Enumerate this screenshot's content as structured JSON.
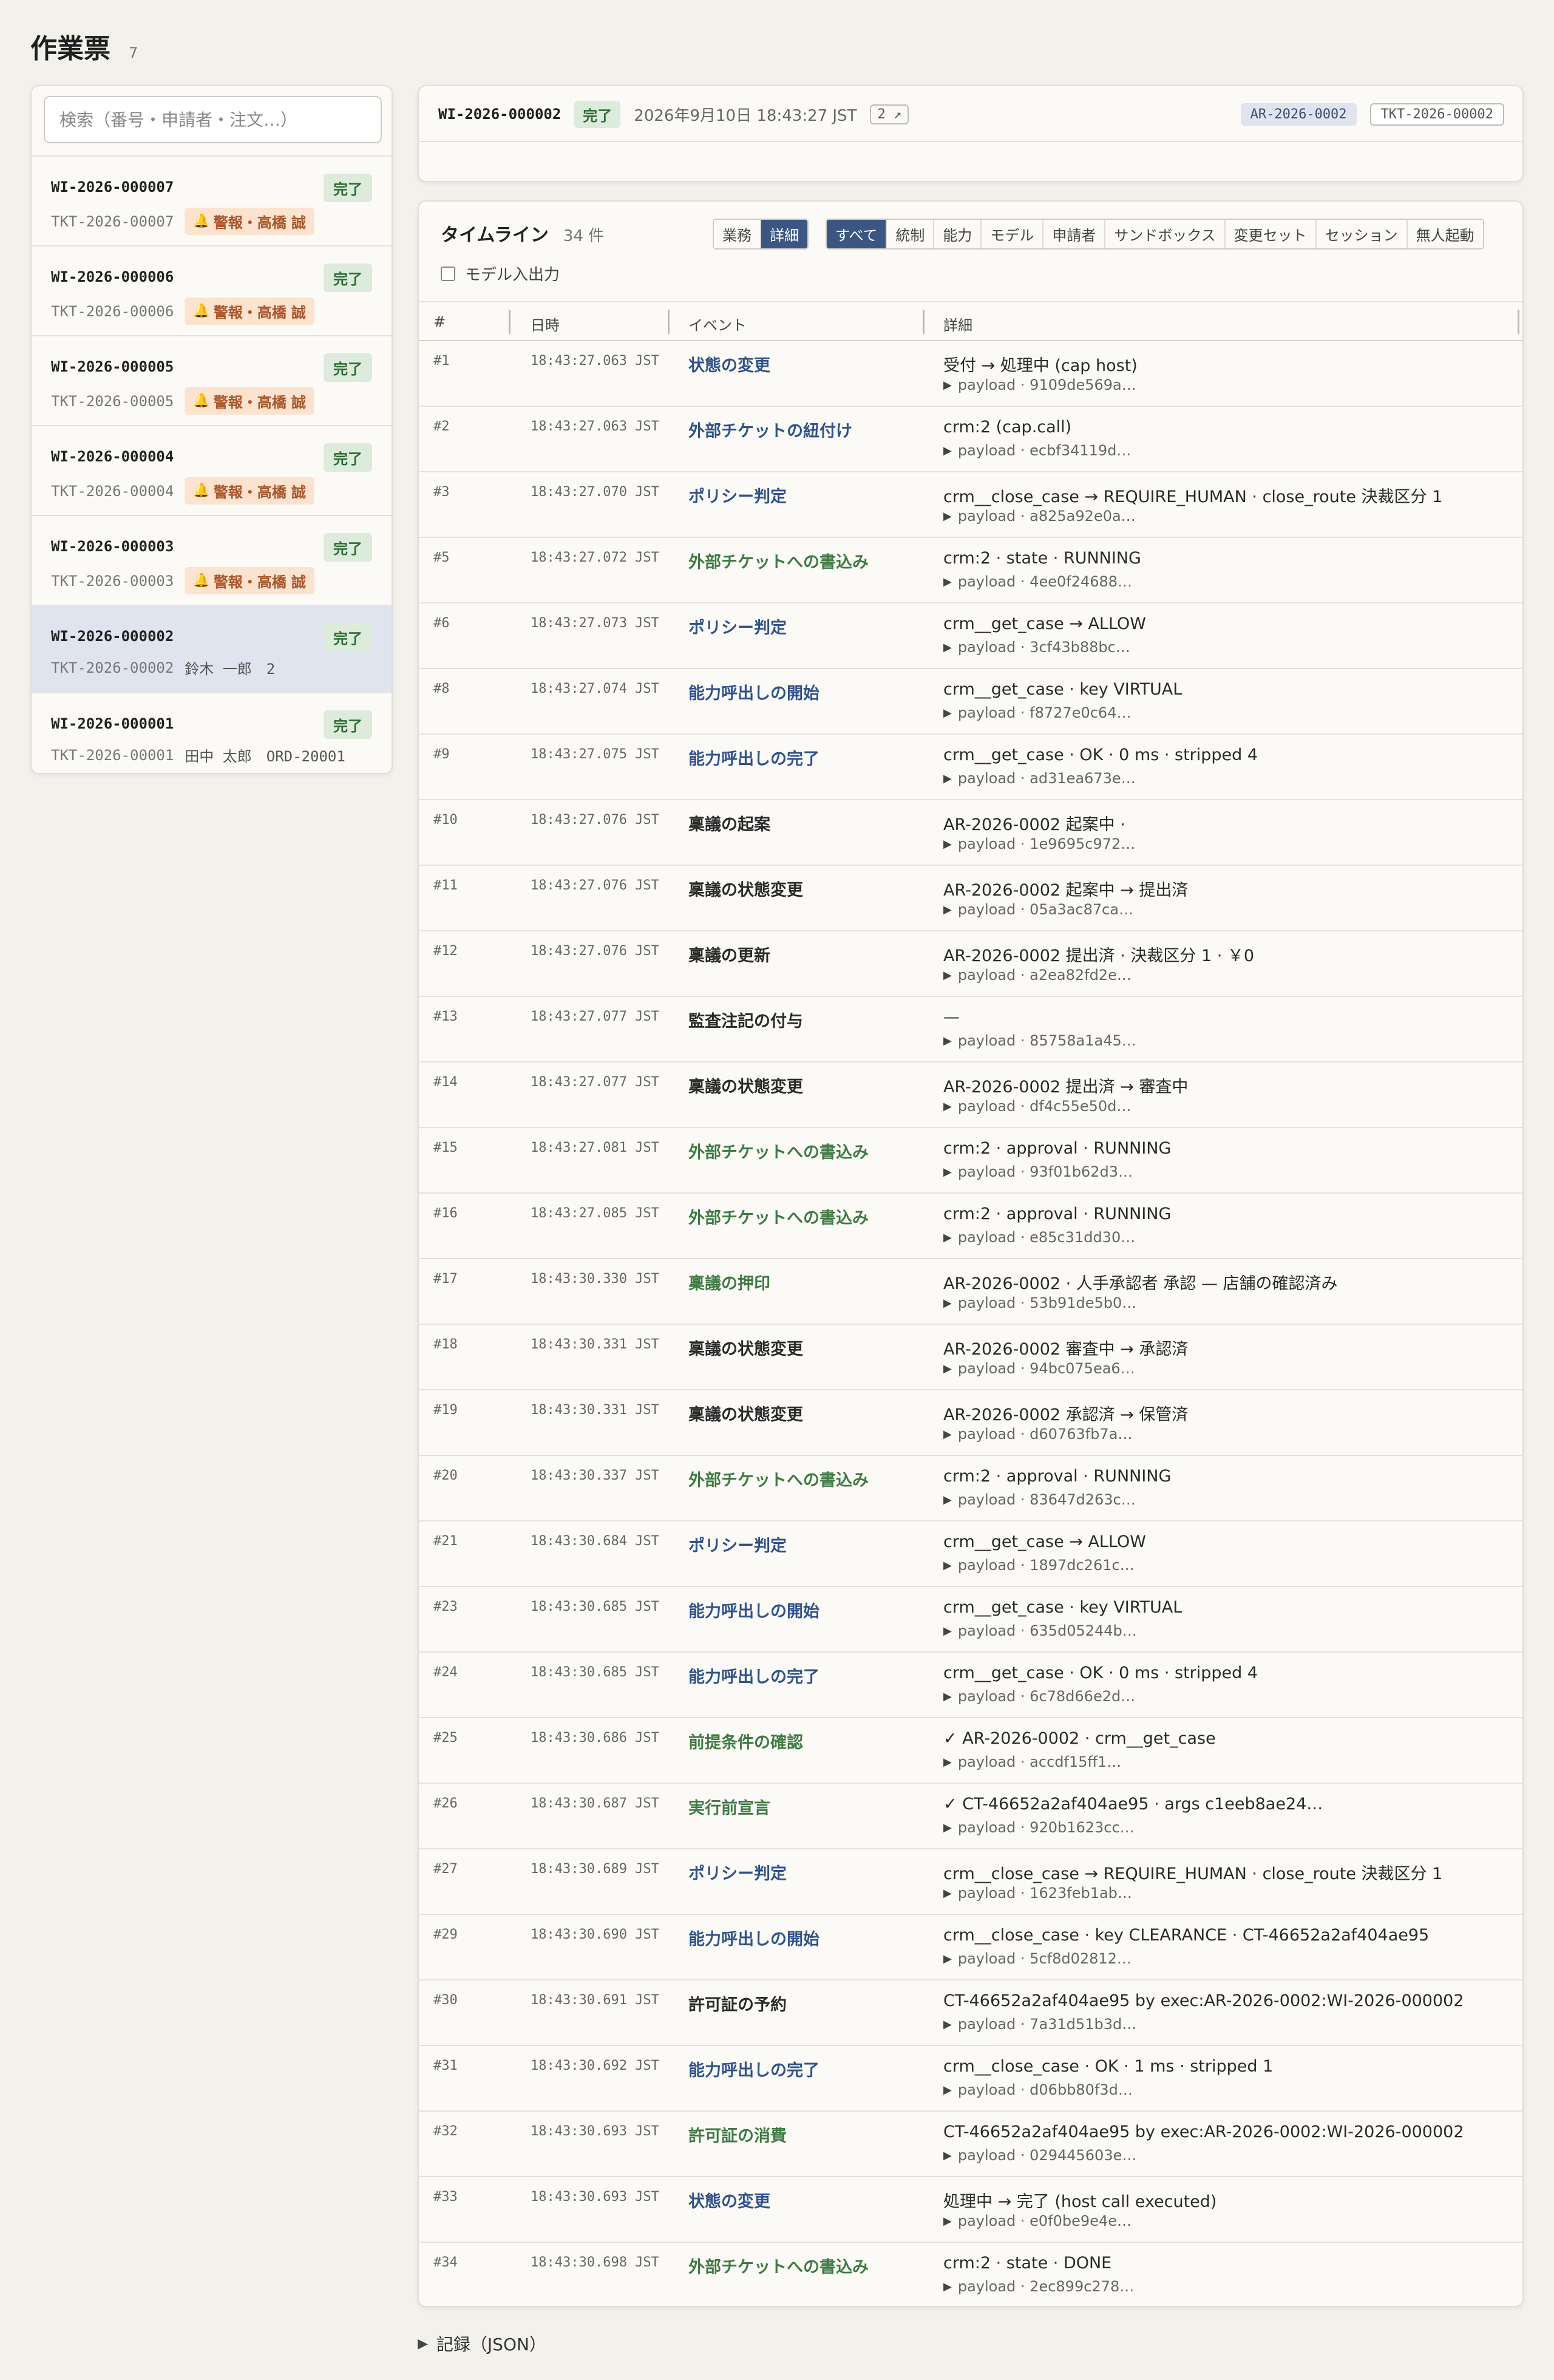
{
  "page": {
    "title": "作業票",
    "count": "7"
  },
  "search": {
    "placeholder": "検索（番号・申請者・注文…）"
  },
  "work_items": [
    {
      "id": "WI-2026-000007",
      "status": "完了",
      "ticket": "TKT-2026-00007",
      "alert": "警報・高橋 誠",
      "meta": "",
      "selected": false
    },
    {
      "id": "WI-2026-000006",
      "status": "完了",
      "ticket": "TKT-2026-00006",
      "alert": "警報・高橋 誠",
      "meta": "",
      "selected": false
    },
    {
      "id": "WI-2026-000005",
      "status": "完了",
      "ticket": "TKT-2026-00005",
      "alert": "警報・高橋 誠",
      "meta": "",
      "selected": false
    },
    {
      "id": "WI-2026-000004",
      "status": "完了",
      "ticket": "TKT-2026-00004",
      "alert": "警報・高橋 誠",
      "meta": "",
      "selected": false
    },
    {
      "id": "WI-2026-000003",
      "status": "完了",
      "ticket": "TKT-2026-00003",
      "alert": "警報・高橋 誠",
      "meta": "",
      "selected": false
    },
    {
      "id": "WI-2026-000002",
      "status": "完了",
      "ticket": "TKT-2026-00002",
      "alert": "",
      "meta": "鈴木 一郎　2",
      "selected": true
    },
    {
      "id": "WI-2026-000001",
      "status": "完了",
      "ticket": "TKT-2026-00001",
      "alert": "",
      "meta": "田中 太郎　ORD-20001",
      "selected": false
    }
  ],
  "header": {
    "id": "WI-2026-000002",
    "status": "完了",
    "date": "2026年9月10日 18:43:27 JST",
    "count_badge": "2 ↗",
    "ar_badge": "AR-2026-0002",
    "tkt_badge": "TKT-2026-00002"
  },
  "timeline": {
    "title": "タイムライン",
    "count": "34 件",
    "view_tabs": [
      {
        "label": "業務",
        "active": false
      },
      {
        "label": "詳細",
        "active": true
      }
    ],
    "filter_tabs": [
      {
        "label": "すべて",
        "active": true
      },
      {
        "label": "統制",
        "active": false
      },
      {
        "label": "能力",
        "active": false
      },
      {
        "label": "モデル",
        "active": false
      },
      {
        "label": "申請者",
        "active": false
      },
      {
        "label": "サンドボックス",
        "active": false
      },
      {
        "label": "変更セット",
        "active": false
      },
      {
        "label": "セッション",
        "active": false
      },
      {
        "label": "無人起動",
        "active": false
      }
    ],
    "model_io_label": "モデル入出力",
    "columns": {
      "num": "#",
      "time": "日時",
      "event": "イベント",
      "detail": "詳細"
    },
    "rows": [
      {
        "num": "#1",
        "time": "18:43:27.063 JST",
        "event": "状態の変更",
        "tone": "blue",
        "detail": "受付 → 処理中 (cap host)",
        "payload": "payload · 9109de569a…"
      },
      {
        "num": "#2",
        "time": "18:43:27.063 JST",
        "event": "外部チケットの紐付け",
        "tone": "blue",
        "detail": "crm:2 (cap.call)",
        "payload": "payload · ecbf34119d…"
      },
      {
        "num": "#3",
        "time": "18:43:27.070 JST",
        "event": "ポリシー判定",
        "tone": "blue",
        "detail": "crm__close_case → REQUIRE_HUMAN · close_route 決裁区分 1",
        "payload": "payload · a825a92e0a…"
      },
      {
        "num": "#5",
        "time": "18:43:27.072 JST",
        "event": "外部チケットへの書込み",
        "tone": "green",
        "detail": "crm:2 · state · RUNNING",
        "payload": "payload · 4ee0f24688…"
      },
      {
        "num": "#6",
        "time": "18:43:27.073 JST",
        "event": "ポリシー判定",
        "tone": "blue",
        "detail": "crm__get_case → ALLOW",
        "payload": "payload · 3cf43b88bc…"
      },
      {
        "num": "#8",
        "time": "18:43:27.074 JST",
        "event": "能力呼出しの開始",
        "tone": "blue",
        "detail": "crm__get_case · key VIRTUAL",
        "payload": "payload · f8727e0c64…"
      },
      {
        "num": "#9",
        "time": "18:43:27.075 JST",
        "event": "能力呼出しの完了",
        "tone": "blue",
        "detail": "crm__get_case · OK · 0 ms · stripped 4",
        "payload": "payload · ad31ea673e…"
      },
      {
        "num": "#10",
        "time": "18:43:27.076 JST",
        "event": "稟議の起案",
        "tone": "dark",
        "detail": "AR-2026-0002 起案中 ·",
        "payload": "payload · 1e9695c972…"
      },
      {
        "num": "#11",
        "time": "18:43:27.076 JST",
        "event": "稟議の状態変更",
        "tone": "dark",
        "detail": "AR-2026-0002 起案中 → 提出済",
        "payload": "payload · 05a3ac87ca…"
      },
      {
        "num": "#12",
        "time": "18:43:27.076 JST",
        "event": "稟議の更新",
        "tone": "dark",
        "detail": "AR-2026-0002 提出済 · 決裁区分 1 · ￥0",
        "payload": "payload · a2ea82fd2e…"
      },
      {
        "num": "#13",
        "time": "18:43:27.077 JST",
        "event": "監査注記の付与",
        "tone": "dark",
        "detail": "—",
        "payload": "payload · 85758a1a45…"
      },
      {
        "num": "#14",
        "time": "18:43:27.077 JST",
        "event": "稟議の状態変更",
        "tone": "dark",
        "detail": "AR-2026-0002 提出済 → 審査中",
        "payload": "payload · df4c55e50d…"
      },
      {
        "num": "#15",
        "time": "18:43:27.081 JST",
        "event": "外部チケットへの書込み",
        "tone": "green",
        "detail": "crm:2 · approval · RUNNING",
        "payload": "payload · 93f01b62d3…"
      },
      {
        "num": "#16",
        "time": "18:43:27.085 JST",
        "event": "外部チケットへの書込み",
        "tone": "green",
        "detail": "crm:2 · approval · RUNNING",
        "payload": "payload · e85c31dd30…"
      },
      {
        "num": "#17",
        "time": "18:43:30.330 JST",
        "event": "稟議の押印",
        "tone": "green",
        "detail": "AR-2026-0002 · 人手承認者 承認 — 店舗の確認済み",
        "payload": "payload · 53b91de5b0…"
      },
      {
        "num": "#18",
        "time": "18:43:30.331 JST",
        "event": "稟議の状態変更",
        "tone": "dark",
        "detail": "AR-2026-0002 審査中 → 承認済",
        "payload": "payload · 94bc075ea6…"
      },
      {
        "num": "#19",
        "time": "18:43:30.331 JST",
        "event": "稟議の状態変更",
        "tone": "dark",
        "detail": "AR-2026-0002 承認済 → 保管済",
        "payload": "payload · d60763fb7a…"
      },
      {
        "num": "#20",
        "time": "18:43:30.337 JST",
        "event": "外部チケットへの書込み",
        "tone": "green",
        "detail": "crm:2 · approval · RUNNING",
        "payload": "payload · 83647d263c…"
      },
      {
        "num": "#21",
        "time": "18:43:30.684 JST",
        "event": "ポリシー判定",
        "tone": "blue",
        "detail": "crm__get_case → ALLOW",
        "payload": "payload · 1897dc261c…"
      },
      {
        "num": "#23",
        "time": "18:43:30.685 JST",
        "event": "能力呼出しの開始",
        "tone": "blue",
        "detail": "crm__get_case · key VIRTUAL",
        "payload": "payload · 635d05244b…"
      },
      {
        "num": "#24",
        "time": "18:43:30.685 JST",
        "event": "能力呼出しの完了",
        "tone": "blue",
        "detail": "crm__get_case · OK · 0 ms · stripped 4",
        "payload": "payload · 6c78d66e2d…"
      },
      {
        "num": "#25",
        "time": "18:43:30.686 JST",
        "event": "前提条件の確認",
        "tone": "green",
        "detail": "✓ AR-2026-0002 · crm__get_case",
        "payload": "payload · accdf15ff1…"
      },
      {
        "num": "#26",
        "time": "18:43:30.687 JST",
        "event": "実行前宣言",
        "tone": "green",
        "detail": "✓ CT-46652a2af404ae95 · args c1eeb8ae24…",
        "payload": "payload · 920b1623cc…"
      },
      {
        "num": "#27",
        "time": "18:43:30.689 JST",
        "event": "ポリシー判定",
        "tone": "blue",
        "detail": "crm__close_case → REQUIRE_HUMAN · close_route 決裁区分 1",
        "payload": "payload · 1623feb1ab…"
      },
      {
        "num": "#29",
        "time": "18:43:30.690 JST",
        "event": "能力呼出しの開始",
        "tone": "blue",
        "detail": "crm__close_case · key CLEARANCE · CT-46652a2af404ae95",
        "payload": "payload · 5cf8d02812…"
      },
      {
        "num": "#30",
        "time": "18:43:30.691 JST",
        "event": "許可証の予約",
        "tone": "dark",
        "detail": "CT-46652a2af404ae95 by exec:AR-2026-0002:WI-2026-000002",
        "payload": "payload · 7a31d51b3d…"
      },
      {
        "num": "#31",
        "time": "18:43:30.692 JST",
        "event": "能力呼出しの完了",
        "tone": "blue",
        "detail": "crm__close_case · OK · 1 ms · stripped 1",
        "payload": "payload · d06bb80f3d…"
      },
      {
        "num": "#32",
        "time": "18:43:30.693 JST",
        "event": "許可証の消費",
        "tone": "green",
        "detail": "CT-46652a2af404ae95 by exec:AR-2026-0002:WI-2026-000002",
        "payload": "payload · 029445603e…"
      },
      {
        "num": "#33",
        "time": "18:43:30.693 JST",
        "event": "状態の変更",
        "tone": "blue",
        "detail": "処理中 → 完了 (host call executed)",
        "payload": "payload · e0f0be9e4e…"
      },
      {
        "num": "#34",
        "time": "18:43:30.698 JST",
        "event": "外部チケットへの書込み",
        "tone": "green",
        "detail": "crm:2 · state · DONE",
        "payload": "payload · 2ec899c278…"
      }
    ]
  },
  "json_toggle": {
    "label": "記録（JSON）"
  },
  "colors": {
    "accent": "#3b5683",
    "status_ok_bg": "#dcebdc",
    "alert_bg": "#fbe3cf",
    "selected_bg": "#dfe4ee"
  }
}
